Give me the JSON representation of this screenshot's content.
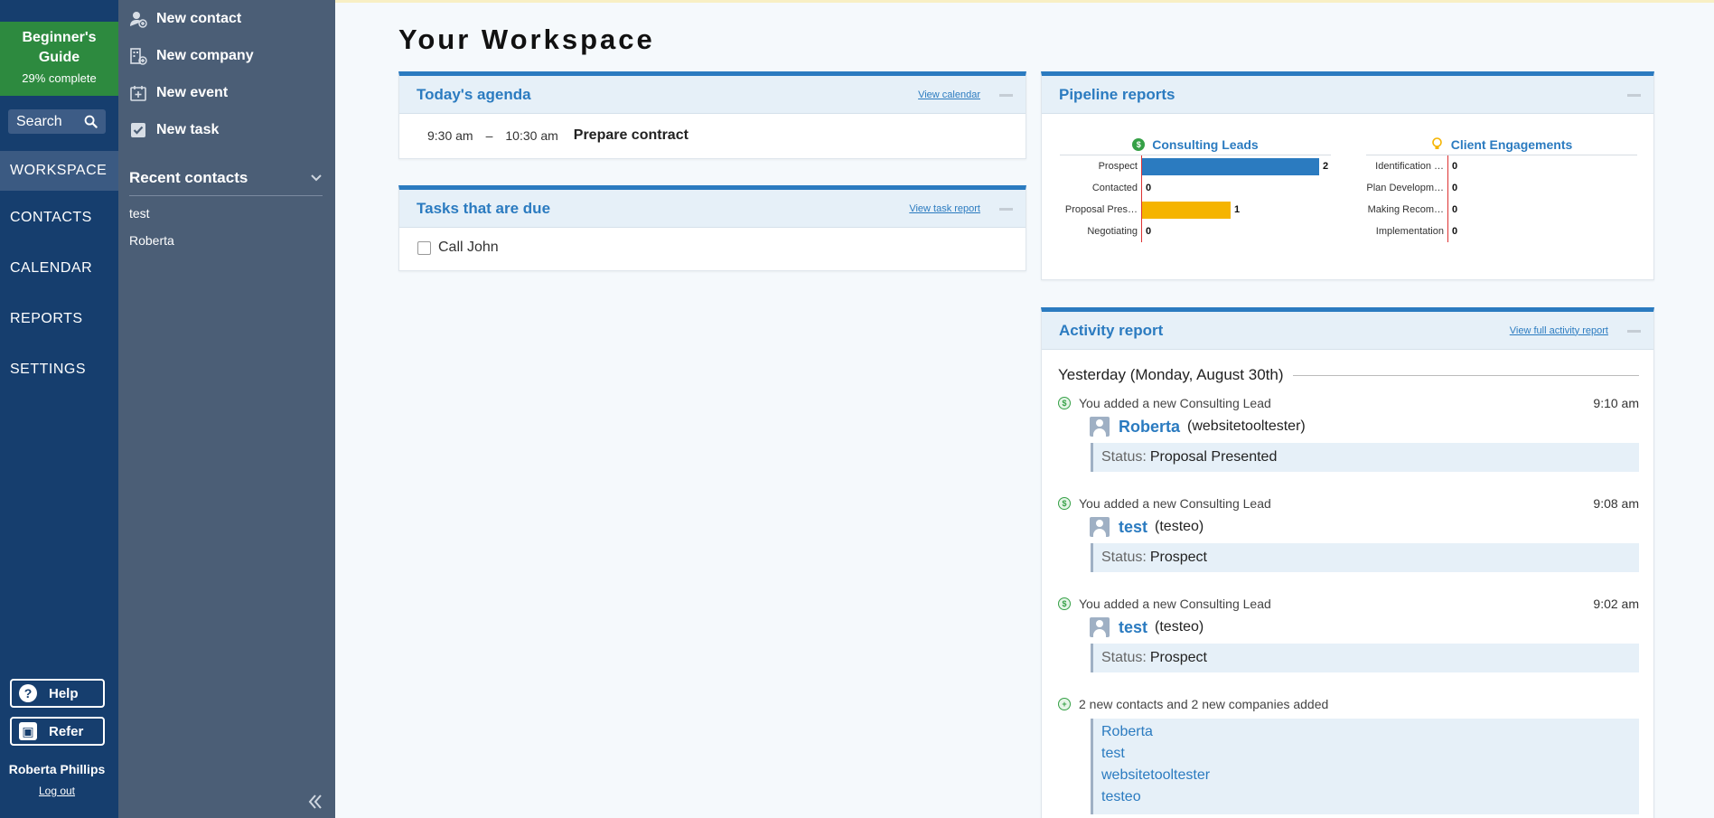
{
  "rail": {
    "guide_title": "Beginner's Guide",
    "guide_progress": "29% complete",
    "search_label": "Search",
    "nav": [
      {
        "label": "WORKSPACE"
      },
      {
        "label": "CONTACTS"
      },
      {
        "label": "CALENDAR"
      },
      {
        "label": "REPORTS"
      },
      {
        "label": "SETTINGS"
      }
    ],
    "help_label": "Help",
    "refer_label": "Refer",
    "user_name": "Roberta Phillips",
    "logout_label": "Log out"
  },
  "panel": {
    "quick_actions": [
      {
        "label": "New contact"
      },
      {
        "label": "New company"
      },
      {
        "label": "New event"
      },
      {
        "label": "New task"
      }
    ],
    "recent_title": "Recent contacts",
    "recent": [
      "test",
      "Roberta"
    ]
  },
  "main": {
    "title": "Your Workspace",
    "agenda": {
      "title": "Today's agenda",
      "link": "View calendar",
      "start": "9:30 am",
      "dash": "–",
      "end": "10:30 am",
      "event": "Prepare contract"
    },
    "tasks": {
      "title": "Tasks that are due",
      "link": "View task report",
      "items": [
        "Call John"
      ]
    },
    "pipeline": {
      "title": "Pipeline reports",
      "colors": {
        "blue": "#2b7bc0",
        "yellow": "#f5b400"
      }
    },
    "activity": {
      "title": "Activity report",
      "link": "View full activity report",
      "day": "Yesterday (Monday, August 30th)",
      "entries": [
        {
          "text": "You added a new Consulting Lead",
          "time": "9:10 am",
          "name": "Roberta",
          "company": "(websitetooltester)",
          "status_label": "Status:",
          "status": "Proposal Presented"
        },
        {
          "text": "You added a new Consulting Lead",
          "time": "9:08 am",
          "name": "test",
          "company": "(testeo)",
          "status_label": "Status:",
          "status": "Prospect"
        },
        {
          "text": "You added a new Consulting Lead",
          "time": "9:02 am",
          "name": "test",
          "company": "(testeo)",
          "status_label": "Status:",
          "status": "Prospect"
        }
      ],
      "added_text": "2 new contacts and 2 new companies added",
      "added": [
        "Roberta",
        "test",
        "websitetooltester",
        "testeo"
      ]
    }
  },
  "chart_data": [
    {
      "type": "bar",
      "title": "Consulting Leads",
      "orientation": "horizontal",
      "categories": [
        "Prospect",
        "Contacted",
        "Proposal Pres…",
        "Negotiating"
      ],
      "values": [
        2,
        0,
        1,
        0
      ],
      "colors": [
        "#2b7bc0",
        "#2b7bc0",
        "#f5b400",
        "#2b7bc0"
      ],
      "xlim": [
        0,
        2
      ]
    },
    {
      "type": "bar",
      "title": "Client Engagements",
      "orientation": "horizontal",
      "categories": [
        "Identification …",
        "Plan Developm…",
        "Making Recom…",
        "Implementation"
      ],
      "values": [
        0,
        0,
        0,
        0
      ],
      "xlim": [
        0,
        2
      ]
    }
  ]
}
